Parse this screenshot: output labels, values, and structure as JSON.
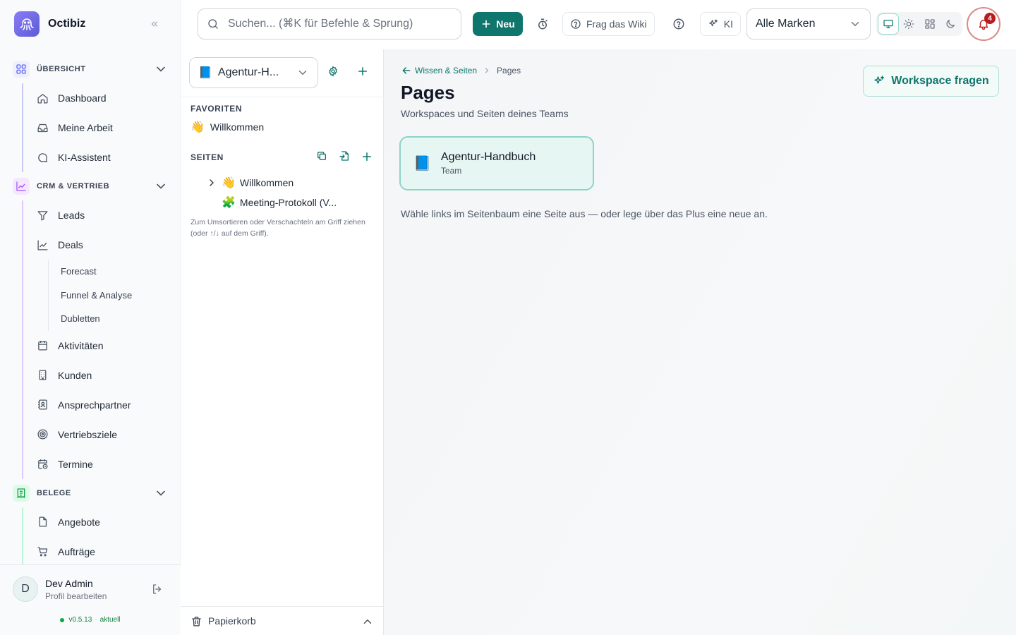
{
  "app": {
    "name": "Octibiz",
    "version": "v0.5.13",
    "version_status": "aktuell"
  },
  "sidebar": {
    "sections": [
      {
        "label": "ÜBERSICHT",
        "icon": "grid-icon",
        "accent": "#6366f1",
        "items": [
          {
            "label": "Dashboard",
            "icon": "home-icon"
          },
          {
            "label": "Meine Arbeit",
            "icon": "inbox-icon"
          },
          {
            "label": "KI-Assistent",
            "icon": "chat-search-icon"
          }
        ]
      },
      {
        "label": "CRM & VERTRIEB",
        "icon": "chart-line-icon",
        "accent": "#a855f7",
        "items": [
          {
            "label": "Leads",
            "icon": "funnel-icon"
          },
          {
            "label": "Deals",
            "icon": "chart-line-icon",
            "subitems": [
              "Forecast",
              "Funnel & Analyse",
              "Dubletten"
            ]
          },
          {
            "label": "Aktivitäten",
            "icon": "calendar-icon"
          },
          {
            "label": "Kunden",
            "icon": "building-icon"
          },
          {
            "label": "Ansprechpartner",
            "icon": "contact-card-icon"
          },
          {
            "label": "Vertriebsziele",
            "icon": "target-icon"
          },
          {
            "label": "Termine",
            "icon": "calendar-clock-icon"
          }
        ]
      },
      {
        "label": "BELEGE",
        "icon": "receipt-icon",
        "accent": "#22c55e",
        "items": [
          {
            "label": "Angebote",
            "icon": "document-icon"
          },
          {
            "label": "Aufträge",
            "icon": "cart-icon"
          }
        ]
      }
    ],
    "user": {
      "initial": "D",
      "name": "Dev Admin",
      "subtitle": "Profil bearbeiten"
    }
  },
  "topbar": {
    "search_placeholder": "Suchen... (⌘K für Befehle & Sprung)",
    "new_label": "Neu",
    "wiki_label": "Frag das Wiki",
    "ai_label": "KI",
    "brand_filter": "Alle Marken",
    "notification_count": "4",
    "view_modes": [
      "monitor-icon",
      "sun-icon",
      "dashboard-icon",
      "moon-icon"
    ]
  },
  "tree": {
    "workspace": {
      "emoji": "📘",
      "label": "Agentur-H..."
    },
    "favorites_heading": "FAVORITEN",
    "favorites": [
      {
        "emoji": "👋",
        "label": "Willkommen"
      }
    ],
    "pages_heading": "SEITEN",
    "pages": [
      {
        "emoji": "👋",
        "label": "Willkommen",
        "has_children": true
      },
      {
        "emoji": "🧩",
        "label": "Meeting-Protokoll (V..."
      }
    ],
    "hint": "Zum Umsortieren oder Verschachteln am Griff ziehen (oder ↑/↓ auf dem Griff).",
    "trash_label": "Papierkorb"
  },
  "main": {
    "breadcrumb": {
      "parent": "Wissen & Seiten",
      "current": "Pages"
    },
    "title": "Pages",
    "subtitle": "Workspaces und Seiten deines Teams",
    "ask_label": "Workspace fragen",
    "workspace_card": {
      "emoji": "📘",
      "title": "Agentur-Handbuch",
      "subtitle": "Team"
    },
    "empty_hint": "Wähle links im Seitenbaum eine Seite aus — oder lege über das Plus eine neue an."
  },
  "colors": {
    "primary": "#0f766e",
    "notification": "#b91c1c"
  }
}
